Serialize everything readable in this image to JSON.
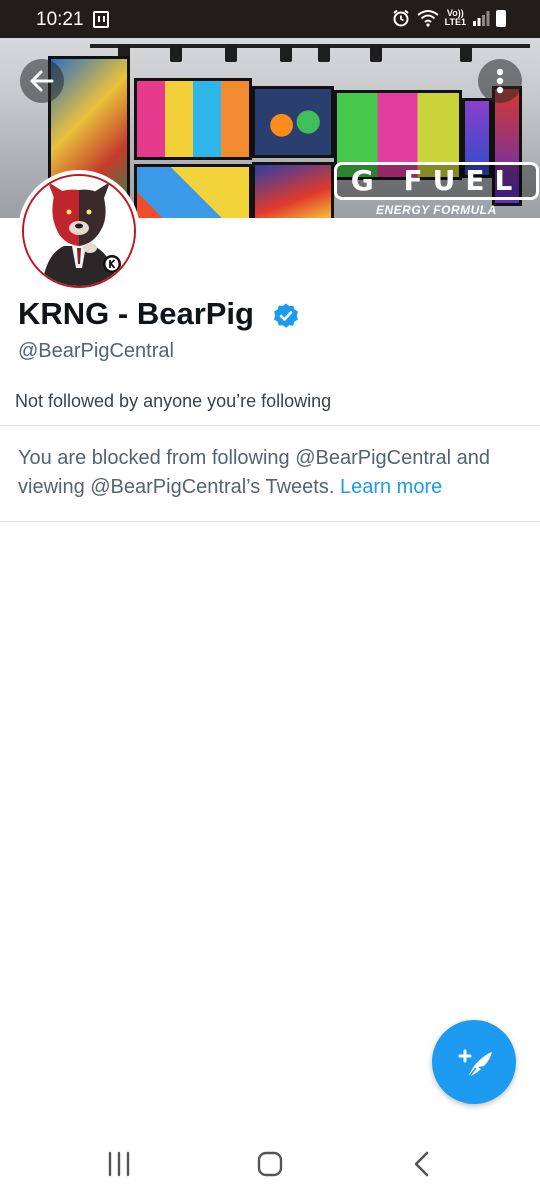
{
  "status_bar": {
    "time": "10:21",
    "network_label_top": "Vo))",
    "network_label_bottom": "LTE1",
    "icons": [
      "twitch-icon",
      "alarm-icon",
      "wifi-icon",
      "signal-icon",
      "battery-icon"
    ]
  },
  "banner": {
    "brand_logo_text": "G FUEL",
    "brand_tagline": "ENERGY FORMULA"
  },
  "profile": {
    "display_name": "KRNG - BearPig",
    "verified": true,
    "handle": "@BearPigCentral",
    "followers_note": "Not followed by anyone you’re following"
  },
  "blocked_notice": {
    "text": "You are blocked from following @BearPigCentral and viewing @BearPigCentral’s Tweets.",
    "learn_more": "Learn more"
  },
  "fab": {
    "icon": "compose-tweet-icon"
  },
  "nav_bar": {
    "icons": [
      "recent-apps-icon",
      "home-icon",
      "back-icon"
    ]
  },
  "colors": {
    "accent": "#1d9bf0",
    "status_bar_bg": "#201d1b",
    "secondary_text": "#536471",
    "avatar_ring": "#c0161f"
  }
}
